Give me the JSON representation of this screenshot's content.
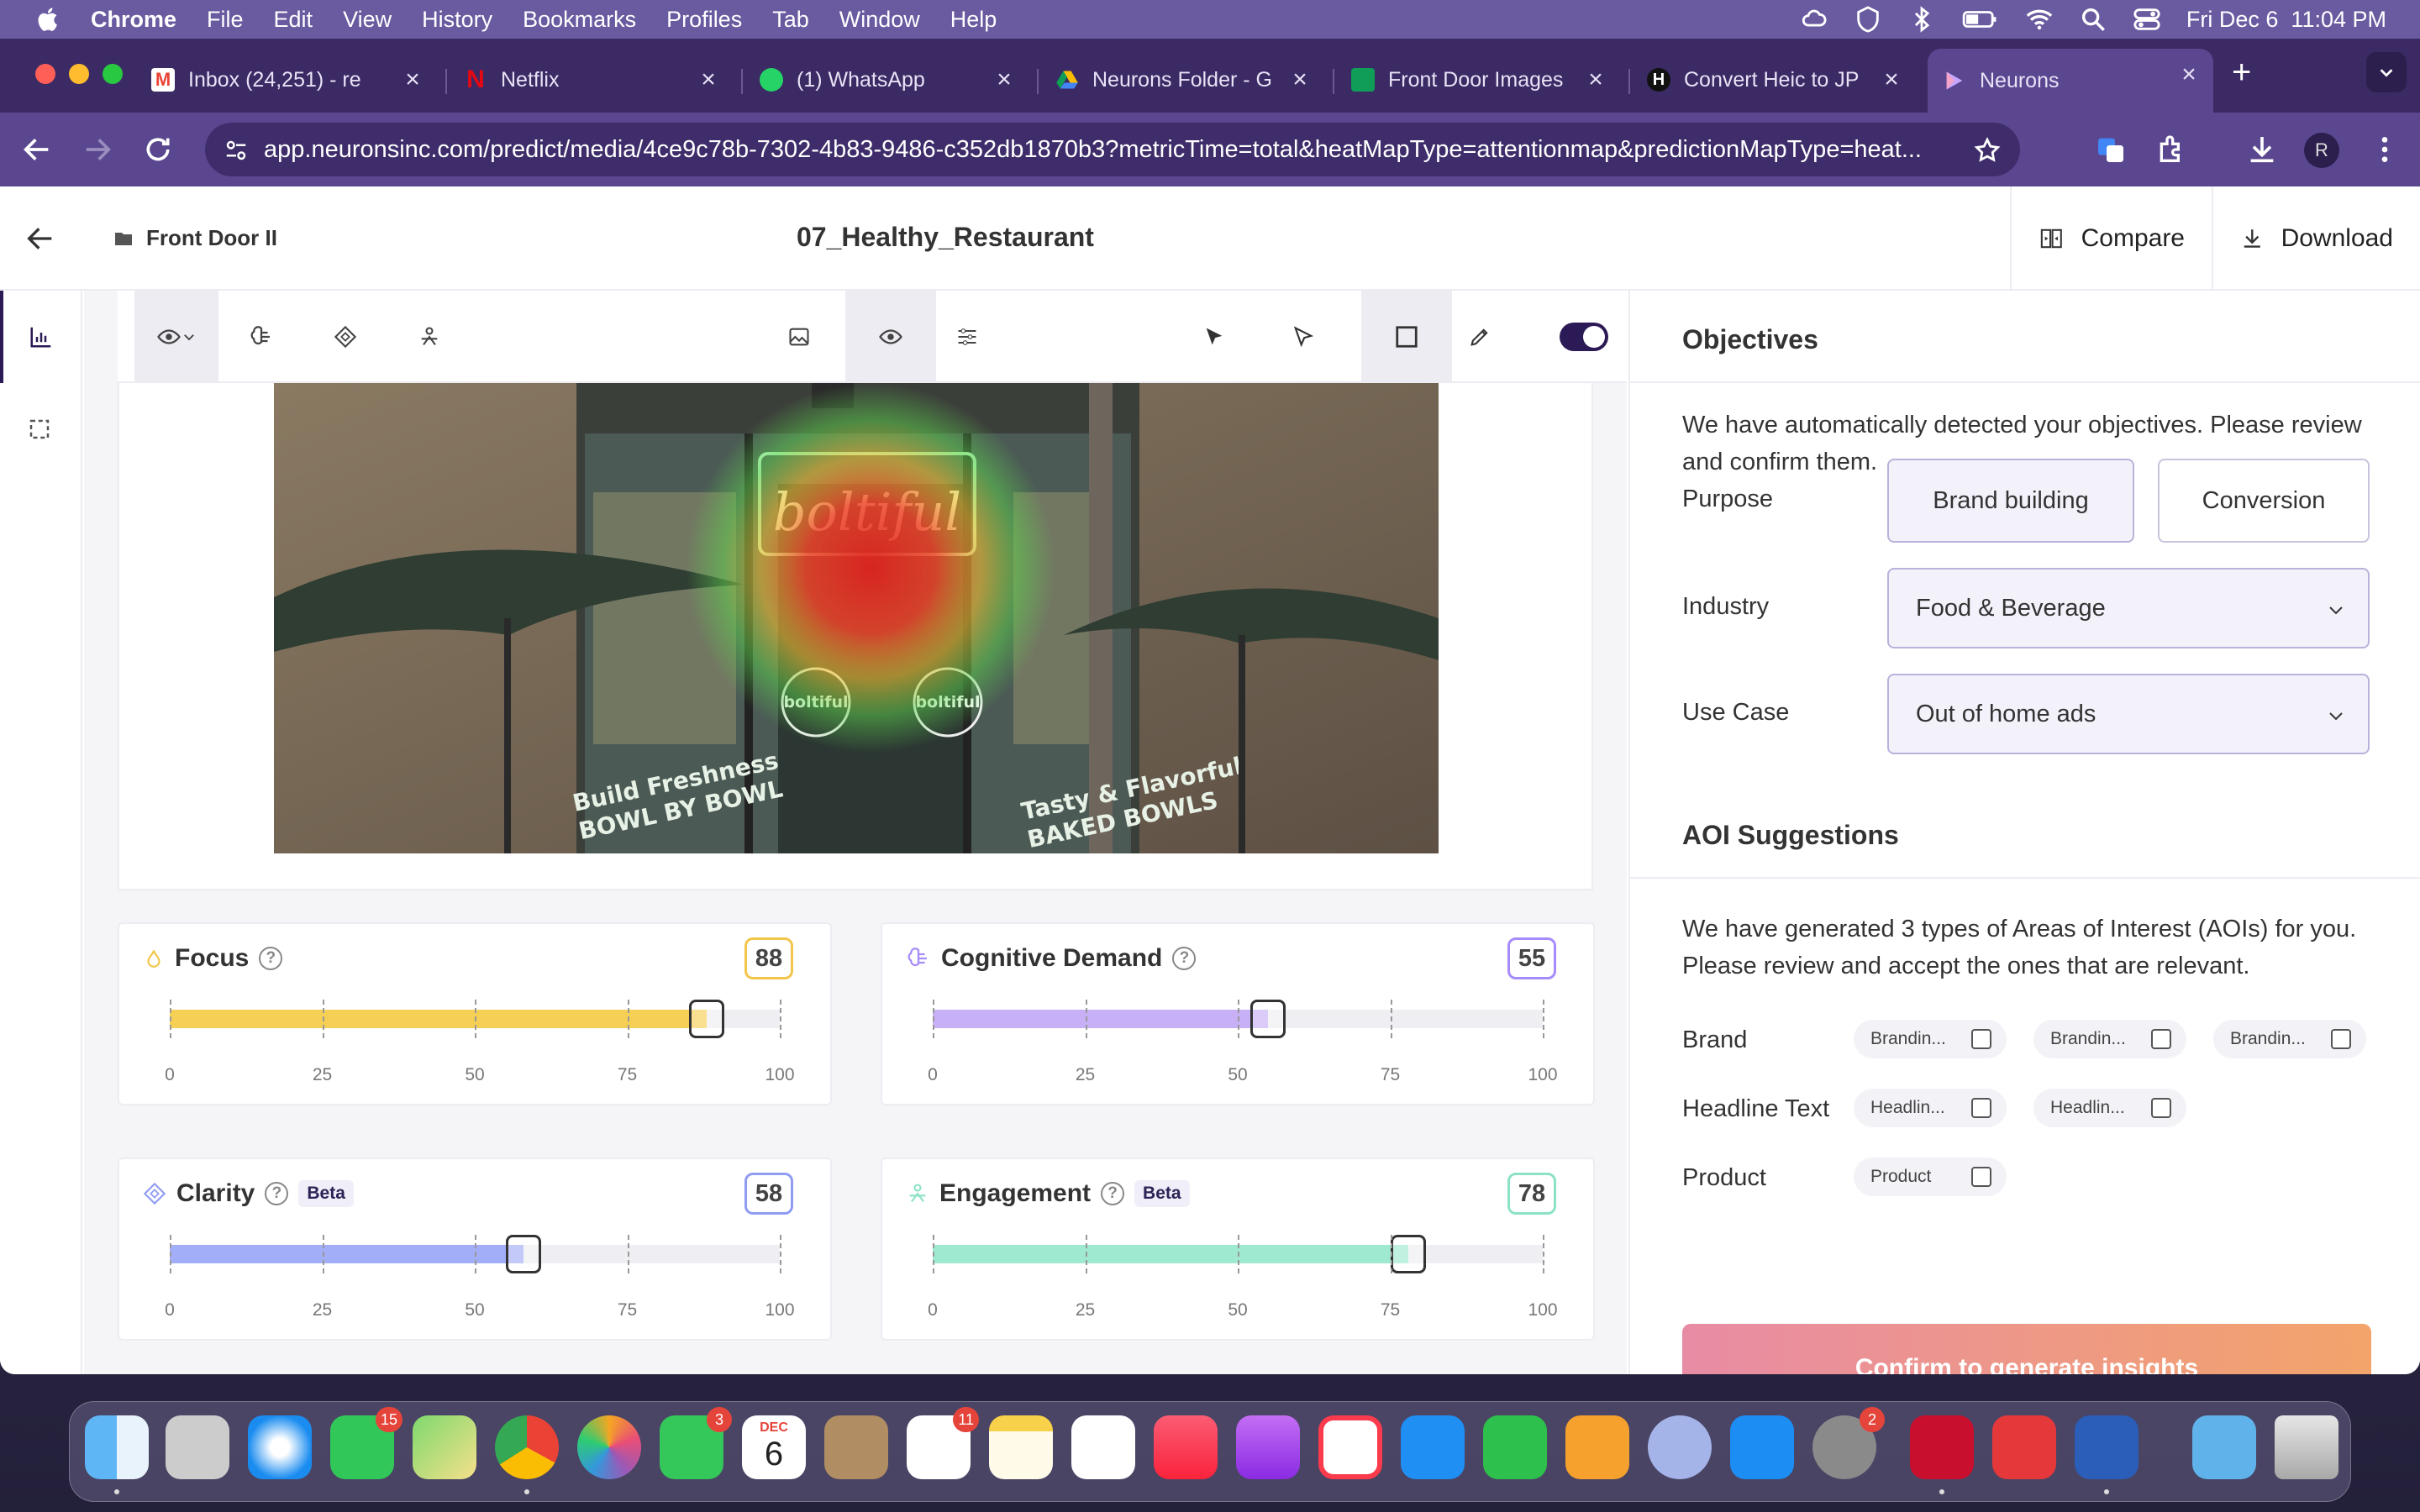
{
  "menubar": {
    "app": "Chrome",
    "items": [
      "File",
      "Edit",
      "View",
      "History",
      "Bookmarks",
      "Profiles",
      "Tab",
      "Window",
      "Help"
    ],
    "clock": "Fri Dec 6  11:04 PM"
  },
  "browser": {
    "tabs": [
      {
        "title": "Inbox (24,251) - re",
        "favicon": "gmail-icon",
        "color": "#ea4335"
      },
      {
        "title": "Netflix",
        "favicon": "netflix-icon",
        "color": "#e50914"
      },
      {
        "title": "(1) WhatsApp",
        "favicon": "whatsapp-icon",
        "color": "#25d366"
      },
      {
        "title": "Neurons Folder - G",
        "favicon": "drive-icon",
        "color": "#fbbc04"
      },
      {
        "title": "Front Door Images",
        "favicon": "sheets-icon",
        "color": "#0f9d58"
      },
      {
        "title": "Convert Heic to JP",
        "favicon": "heic-icon",
        "color": "#111111"
      },
      {
        "title": "Neurons",
        "favicon": "neurons-icon",
        "color": "#c7a6ff"
      }
    ],
    "url": "app.neuronsinc.com/predict/media/4ce9c78b-7302-4b83-9486-c352db1870b3?metricTime=total&heatMapType=attentionmap&predictionMapType=heat...",
    "profile_initial": "R"
  },
  "app": {
    "folder": "Front Door II",
    "media_title": "07_Healthy_Restaurant",
    "compare_label": "Compare",
    "download_label": "Download",
    "help_label": "?"
  },
  "photo": {
    "sign_texts": [
      "boltiful",
      "boltiful",
      "boltiful"
    ],
    "window_text_left": "Build Freshness\nBOWL BY BOWL",
    "window_text_right": "Tasty & Flavorful\nBAKED BOWLS"
  },
  "metrics": [
    {
      "name": "Focus",
      "score": "88",
      "value": 88,
      "color": "#f6cf55",
      "border": "#f3c54a",
      "beta": false
    },
    {
      "name": "Cognitive Demand",
      "score": "55",
      "value": 55,
      "color": "#c7b0f5",
      "border": "#a78bfa",
      "beta": false
    },
    {
      "name": "Clarity",
      "score": "58",
      "value": 58,
      "color": "#a3aef8",
      "border": "#8f9cf2",
      "beta": true
    },
    {
      "name": "Engagement",
      "score": "78",
      "value": 78,
      "color": "#9ee9cf",
      "border": "#8be3c4",
      "beta": true
    }
  ],
  "scale_labels": [
    "0",
    "25",
    "50",
    "75",
    "100"
  ],
  "beta_label": "Beta",
  "objectives": {
    "title": "Objectives",
    "description": "We have automatically detected your objectives. Please review and confirm them.",
    "purpose_label": "Purpose",
    "purpose_options": [
      "Brand building",
      "Conversion"
    ],
    "industry_label": "Industry",
    "industry_value": "Food & Beverage",
    "usecase_label": "Use Case",
    "usecase_value": "Out of home ads"
  },
  "aoi": {
    "title": "AOI Suggestions",
    "description": "We have generated 3 types of Areas of Interest (AOIs) for you. Please review and accept the ones that are relevant.",
    "groups": [
      {
        "label": "Brand",
        "chips": [
          "Brandin...",
          "Brandin...",
          "Brandin..."
        ]
      },
      {
        "label": "Headline Text",
        "chips": [
          "Headlin...",
          "Headlin..."
        ]
      },
      {
        "label": "Product",
        "chips": [
          "Product"
        ]
      }
    ],
    "confirm_label": "Confirm to generate insights"
  },
  "dock": {
    "badges": {
      "messages": "15",
      "facetime": "3",
      "reminders": "11",
      "settings": "2"
    },
    "calendar_month": "DEC",
    "calendar_day": "6"
  }
}
